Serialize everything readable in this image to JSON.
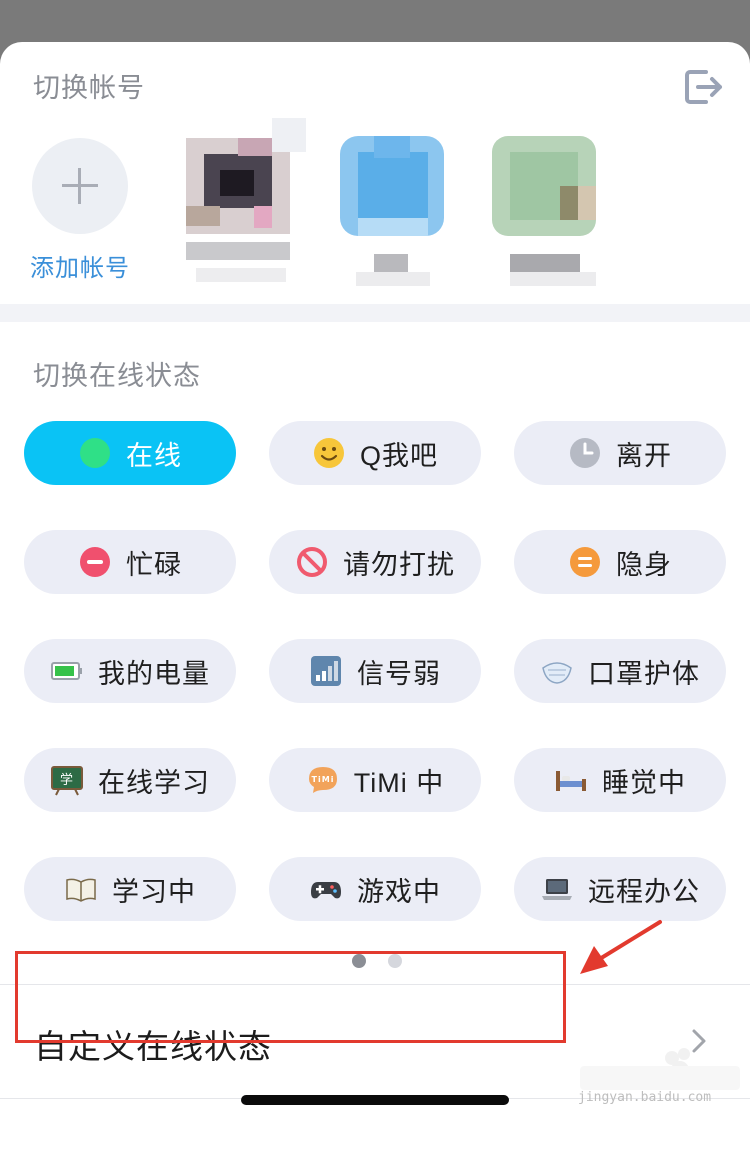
{
  "account_section": {
    "title": "切换帐号",
    "add_label": "添加帐号",
    "logout_icon": "logout-icon"
  },
  "status_section": {
    "title": "切换在线状态",
    "statuses": [
      {
        "label": "在线",
        "icon": "online-dot-icon",
        "active": true
      },
      {
        "label": "Q我吧",
        "icon": "smiley-icon",
        "active": false
      },
      {
        "label": "离开",
        "icon": "clock-icon",
        "active": false
      },
      {
        "label": "忙碌",
        "icon": "minus-circle-icon",
        "active": false
      },
      {
        "label": "请勿打扰",
        "icon": "no-entry-icon",
        "active": false
      },
      {
        "label": "隐身",
        "icon": "equals-circle-icon",
        "active": false
      },
      {
        "label": "我的电量",
        "icon": "battery-icon",
        "active": false
      },
      {
        "label": "信号弱",
        "icon": "signal-icon",
        "active": false
      },
      {
        "label": "口罩护体",
        "icon": "mask-icon",
        "active": false
      },
      {
        "label": "在线学习",
        "icon": "blackboard-icon",
        "active": false
      },
      {
        "label": "TiMi 中",
        "icon": "timi-icon",
        "active": false
      },
      {
        "label": "睡觉中",
        "icon": "bed-icon",
        "active": false
      },
      {
        "label": "学习中",
        "icon": "book-icon",
        "active": false
      },
      {
        "label": "游戏中",
        "icon": "gamepad-icon",
        "active": false
      },
      {
        "label": "远程办公",
        "icon": "laptop-icon",
        "active": false
      }
    ],
    "page_count": 2,
    "current_page": 1
  },
  "custom_status": {
    "label": "自定义在线状态",
    "chevron_icon": "chevron-right-icon"
  },
  "watermark": {
    "text": "jingyan.baidu.com"
  },
  "colors": {
    "active": "#0ac3f5",
    "button_bg": "#ebedf6",
    "link": "#3a8fd9",
    "annotation_red": "#e23a2e"
  }
}
